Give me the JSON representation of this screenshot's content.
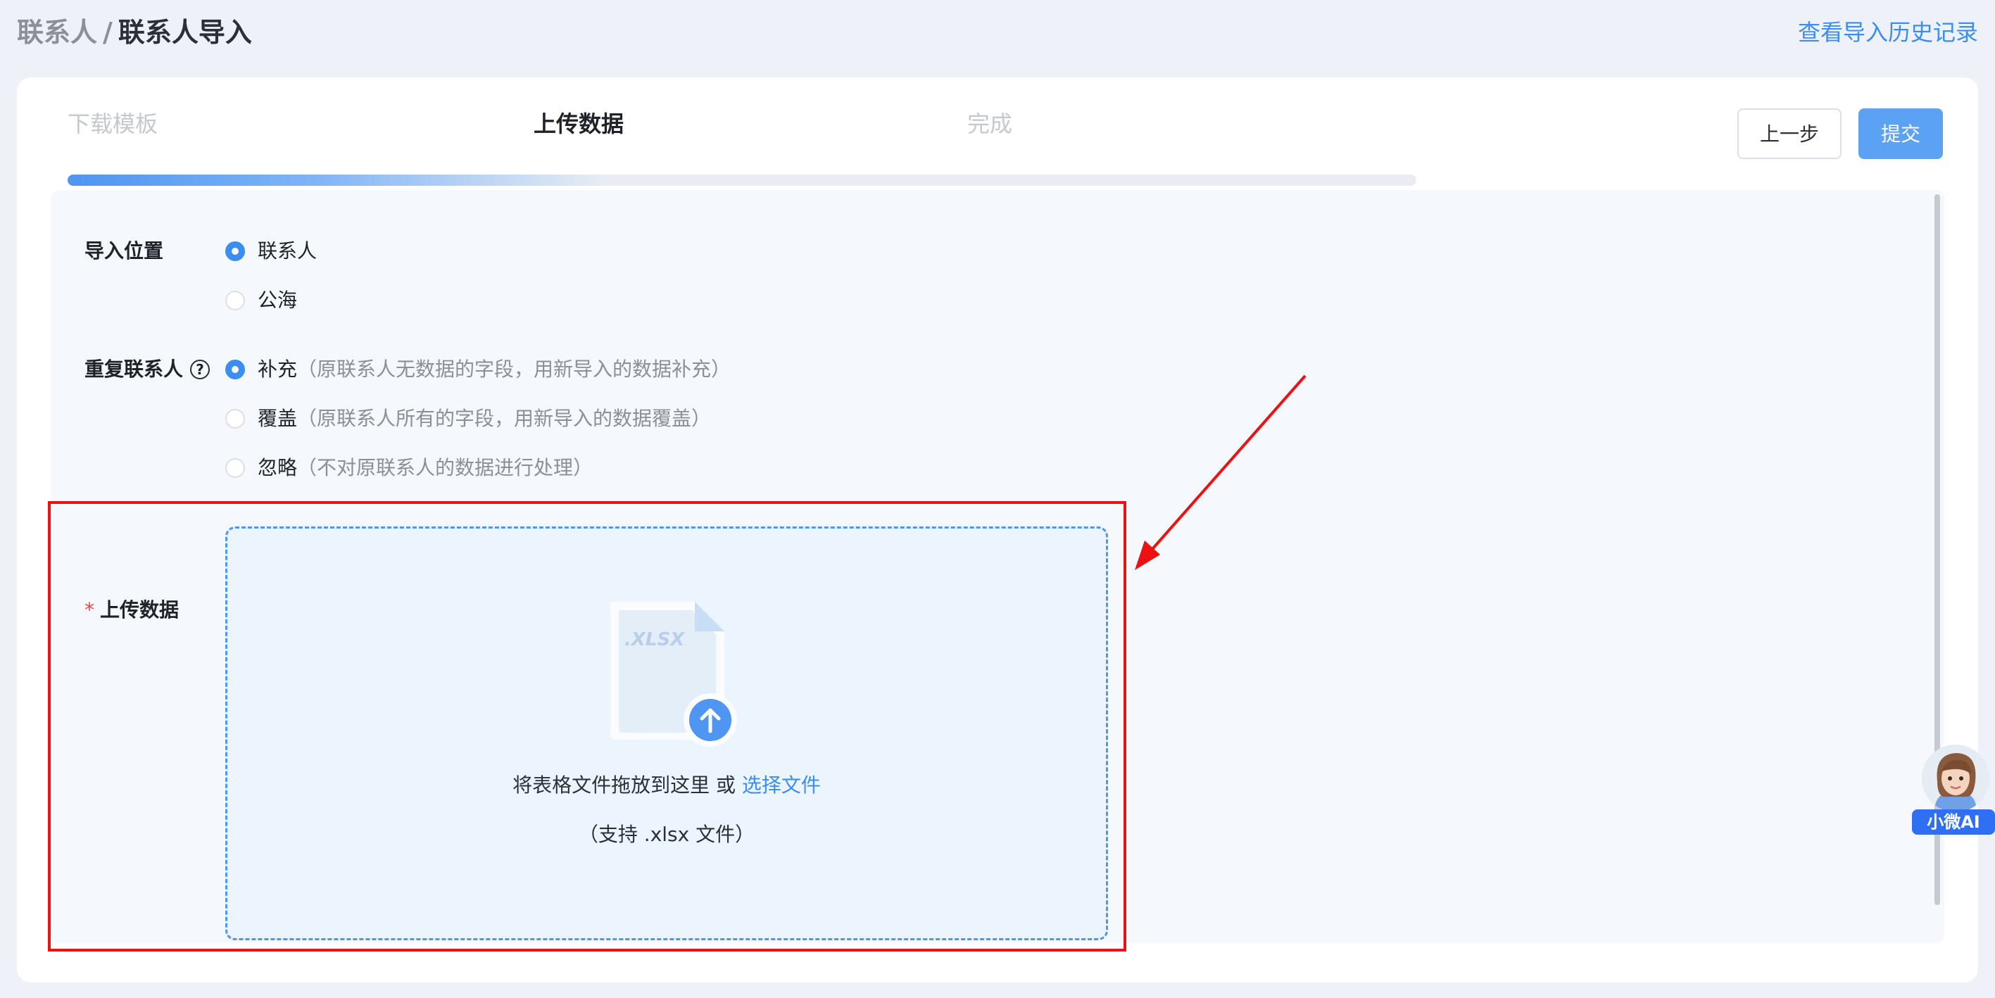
{
  "header": {
    "breadcrumb_parent": "联系人",
    "breadcrumb_separator": "/",
    "breadcrumb_current": "联系人导入",
    "history_link": "查看导入历史记录"
  },
  "steps": {
    "items": [
      {
        "label": "下载模板",
        "state": "done"
      },
      {
        "label": "上传数据",
        "state": "active"
      },
      {
        "label": "完成",
        "state": "pending"
      }
    ],
    "progress_percent": 40
  },
  "actions": {
    "prev_label": "上一步",
    "submit_label": "提交"
  },
  "form": {
    "import_location": {
      "label": "导入位置",
      "options": [
        {
          "label": "联系人",
          "checked": true
        },
        {
          "label": "公海",
          "checked": false
        }
      ]
    },
    "duplicate": {
      "label": "重复联系人",
      "help_icon": "question-circle-icon",
      "options": [
        {
          "label": "补充",
          "desc": "（原联系人无数据的字段，用新导入的数据补充）",
          "checked": true
        },
        {
          "label": "覆盖",
          "desc": "（原联系人所有的字段，用新导入的数据覆盖）",
          "checked": false
        },
        {
          "label": "忽略",
          "desc": "（不对原联系人的数据进行处理）",
          "checked": false
        }
      ]
    },
    "upload": {
      "required_mark": "*",
      "label": "上传数据",
      "file_badge": ".XLSX",
      "drop_text": "将表格文件拖放到这里 或",
      "choose_file": "选择文件",
      "hint": "（支持 .xlsx 文件）"
    }
  },
  "assistant": {
    "badge": "小微AI"
  },
  "colors": {
    "accent": "#3b8ef0",
    "submit": "#5ba2f5",
    "annotation": "#ee1111",
    "required": "#f24444"
  }
}
